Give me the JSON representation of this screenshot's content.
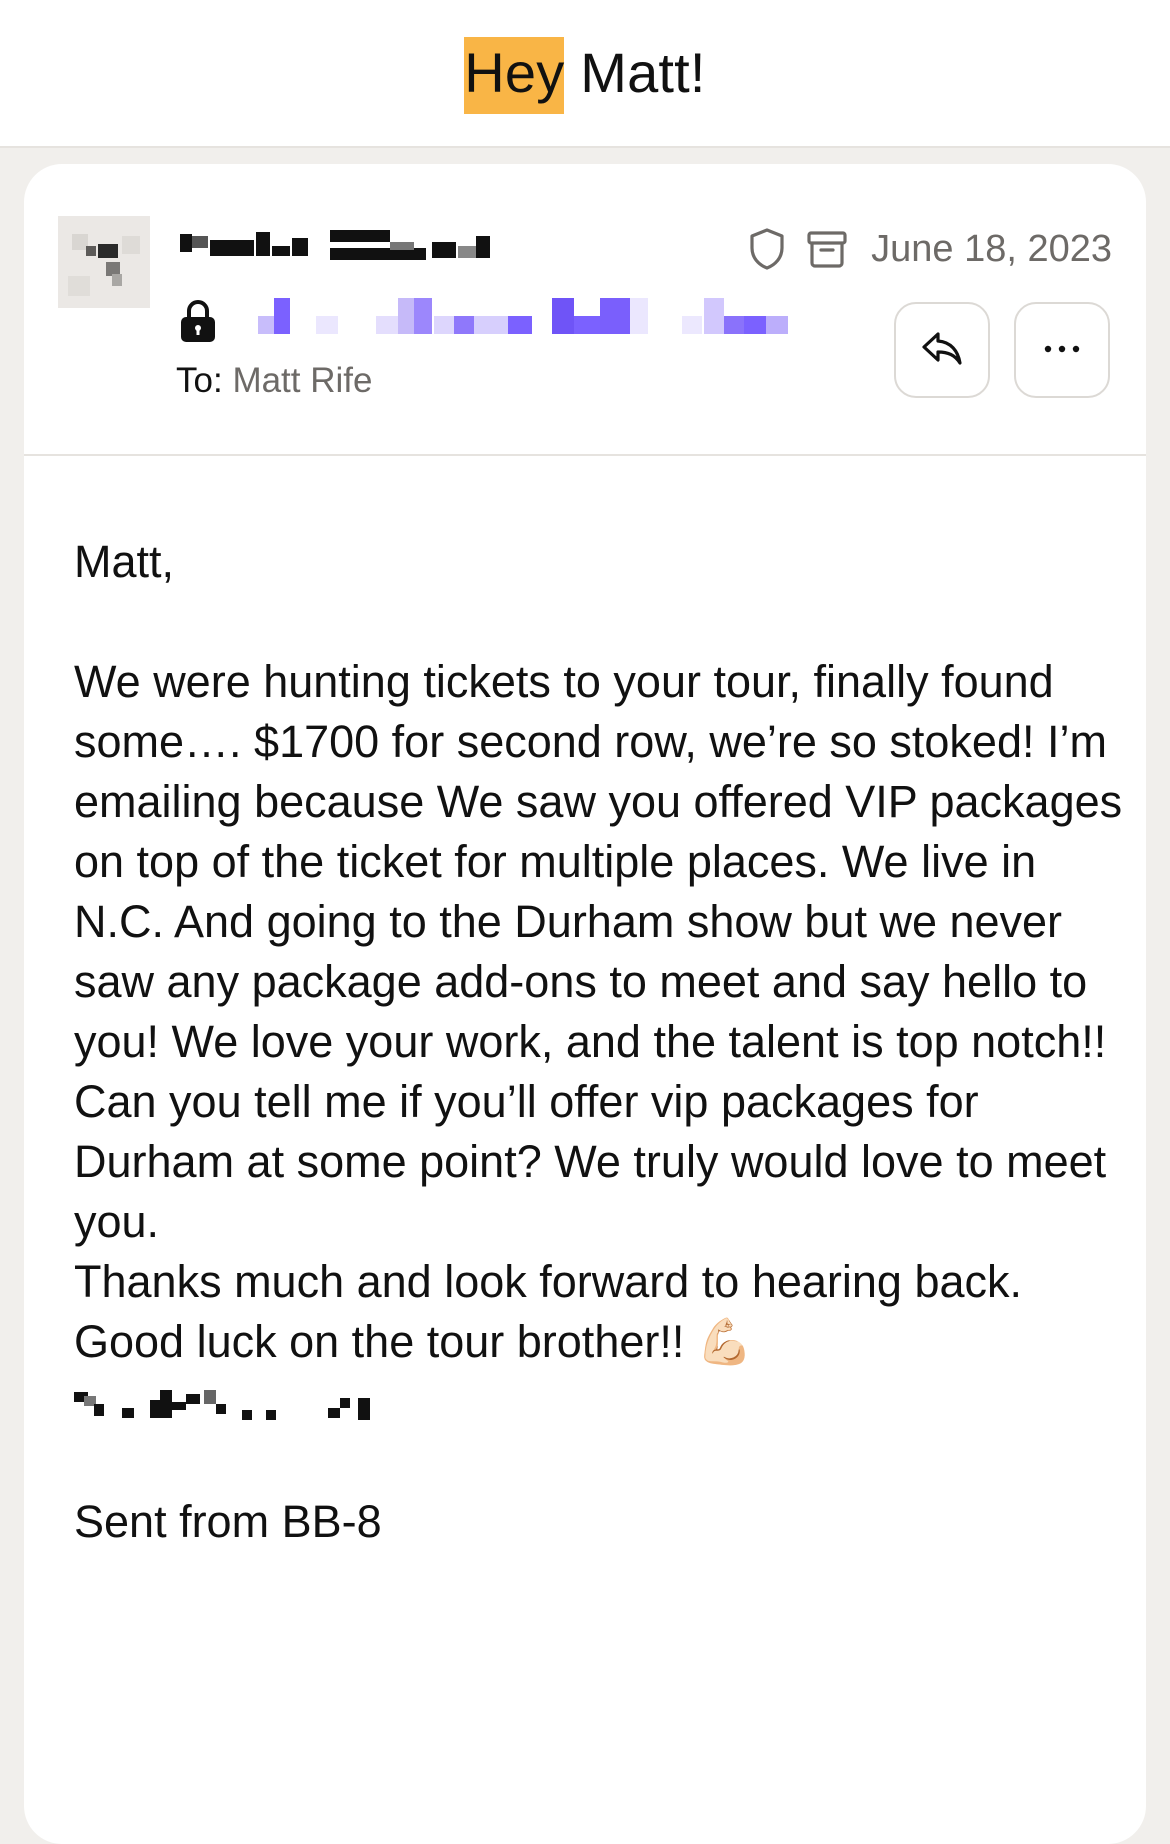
{
  "subject": {
    "highlight": "Hey",
    "rest": " Matt!"
  },
  "sender": {
    "name": "",
    "email": "",
    "to_label": "To:",
    "to_name": "Matt Rife"
  },
  "meta": {
    "date": "June 18, 2023",
    "shield_icon": "shield-icon",
    "archive_icon": "archive-icon",
    "reply_icon": "reply-icon",
    "more_icon": "more-icon"
  },
  "body": {
    "greeting": "Matt,",
    "paragraph": "We were hunting tickets to your tour, finally found some…. $1700 for second row, we’re so stoked! I’m emailing because We saw you offered VIP packages on top of the ticket for multiple places. We live in N.C. And going to the Durham show but we never saw any package add-ons to meet and say hello to you! We love your work, and the talent is top notch!! Can you tell me if you’ll offer vip packages for Durham at some point? We truly would love to meet you.",
    "thanks": "Thanks much and look forward to hearing back.",
    "goodluck": "Good luck on the tour brother!!",
    "goodluck_emoji": "💪🏻",
    "signature": "",
    "sent_from": "Sent from BB-8"
  },
  "colors": {
    "highlight": "#f9b546",
    "background": "#f1efec",
    "muted_text": "#6d6a67",
    "redaction_purple": "#7b61ff"
  }
}
